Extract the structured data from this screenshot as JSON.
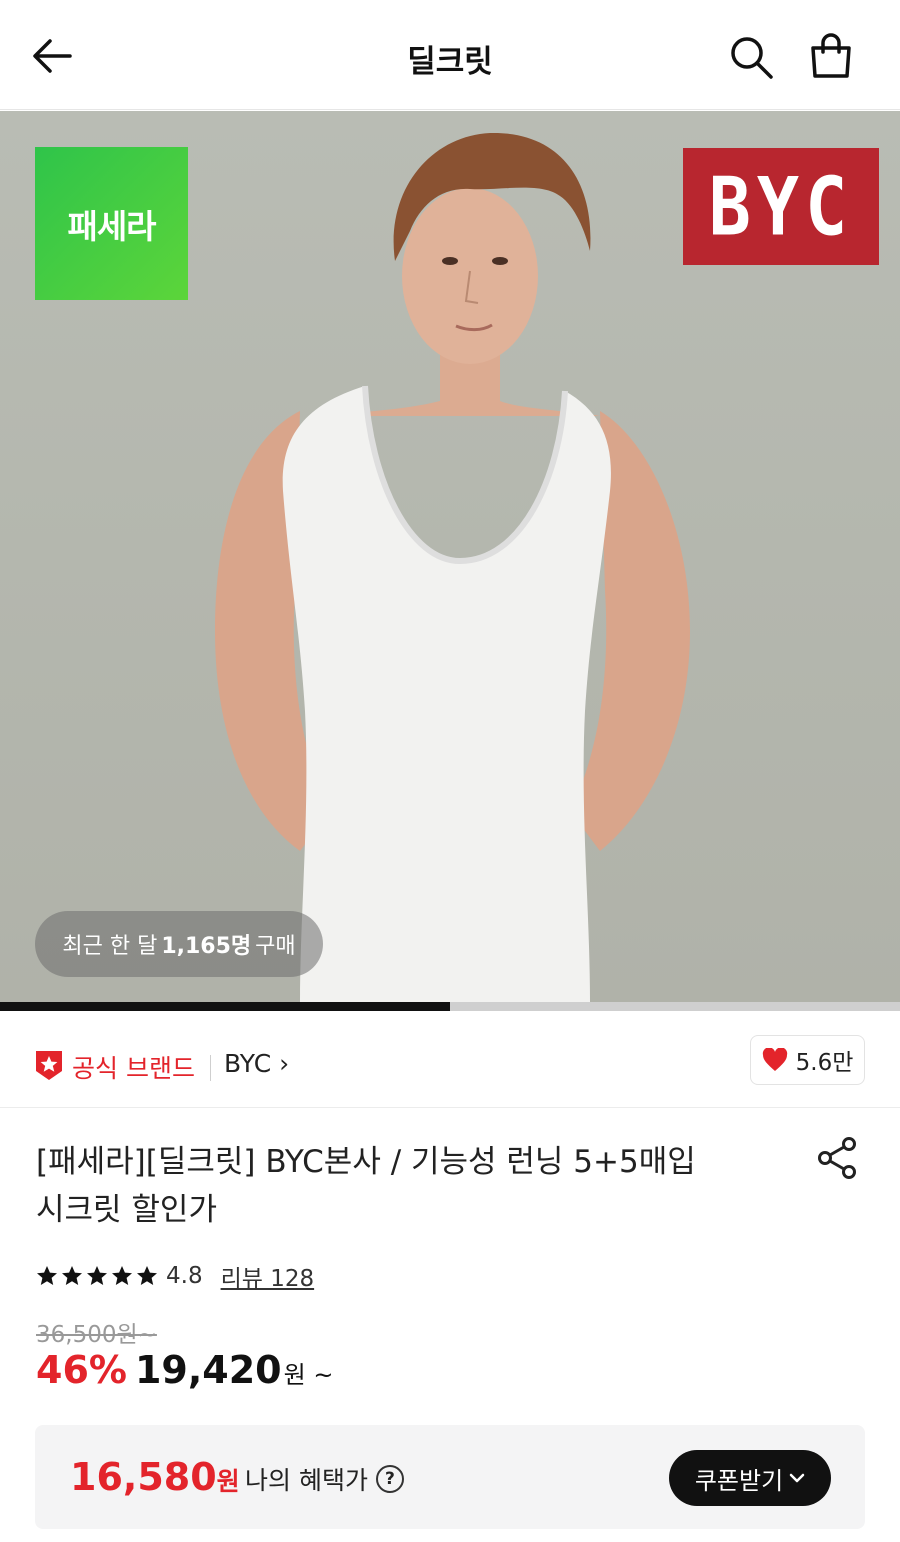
{
  "header": {
    "title": "딜크릿"
  },
  "hero": {
    "logo_left_text": "패세라",
    "logo_right_text": "BYC",
    "buy_badge": {
      "prefix": "최근 한 달",
      "count": "1,165명",
      "suffix": "구매"
    },
    "slide_progress": 0.5
  },
  "brand": {
    "official_label": "공식 브랜드",
    "brand_name": "BYC",
    "brand_chevron": "›",
    "likes": "5.6만"
  },
  "product": {
    "title_line1": "[패세라][딜크릿] BYC본사 / 기능성 런닝 5+5매입",
    "title_line2": "시크릿 할인가",
    "rating": "4.8",
    "star_count": 5,
    "reviews_label": "리뷰 128",
    "original_price": "36,500원~",
    "discount": "46%",
    "price": "19,420",
    "price_unit": "원 ~"
  },
  "benefit": {
    "price": "16,580",
    "price_unit": "원",
    "label": "나의 혜택가",
    "help_symbol": "?",
    "coupon_button": "쿠폰받기"
  },
  "colors": {
    "accent_red": "#e3242b",
    "byc_red": "#b8262f",
    "green": "#2fc44a"
  },
  "icons": [
    "back-arrow-icon",
    "search-icon",
    "shopping-bag-icon",
    "official-badge-icon",
    "heart-icon",
    "share-icon",
    "star-icon",
    "help-icon",
    "chevron-down-icon"
  ]
}
